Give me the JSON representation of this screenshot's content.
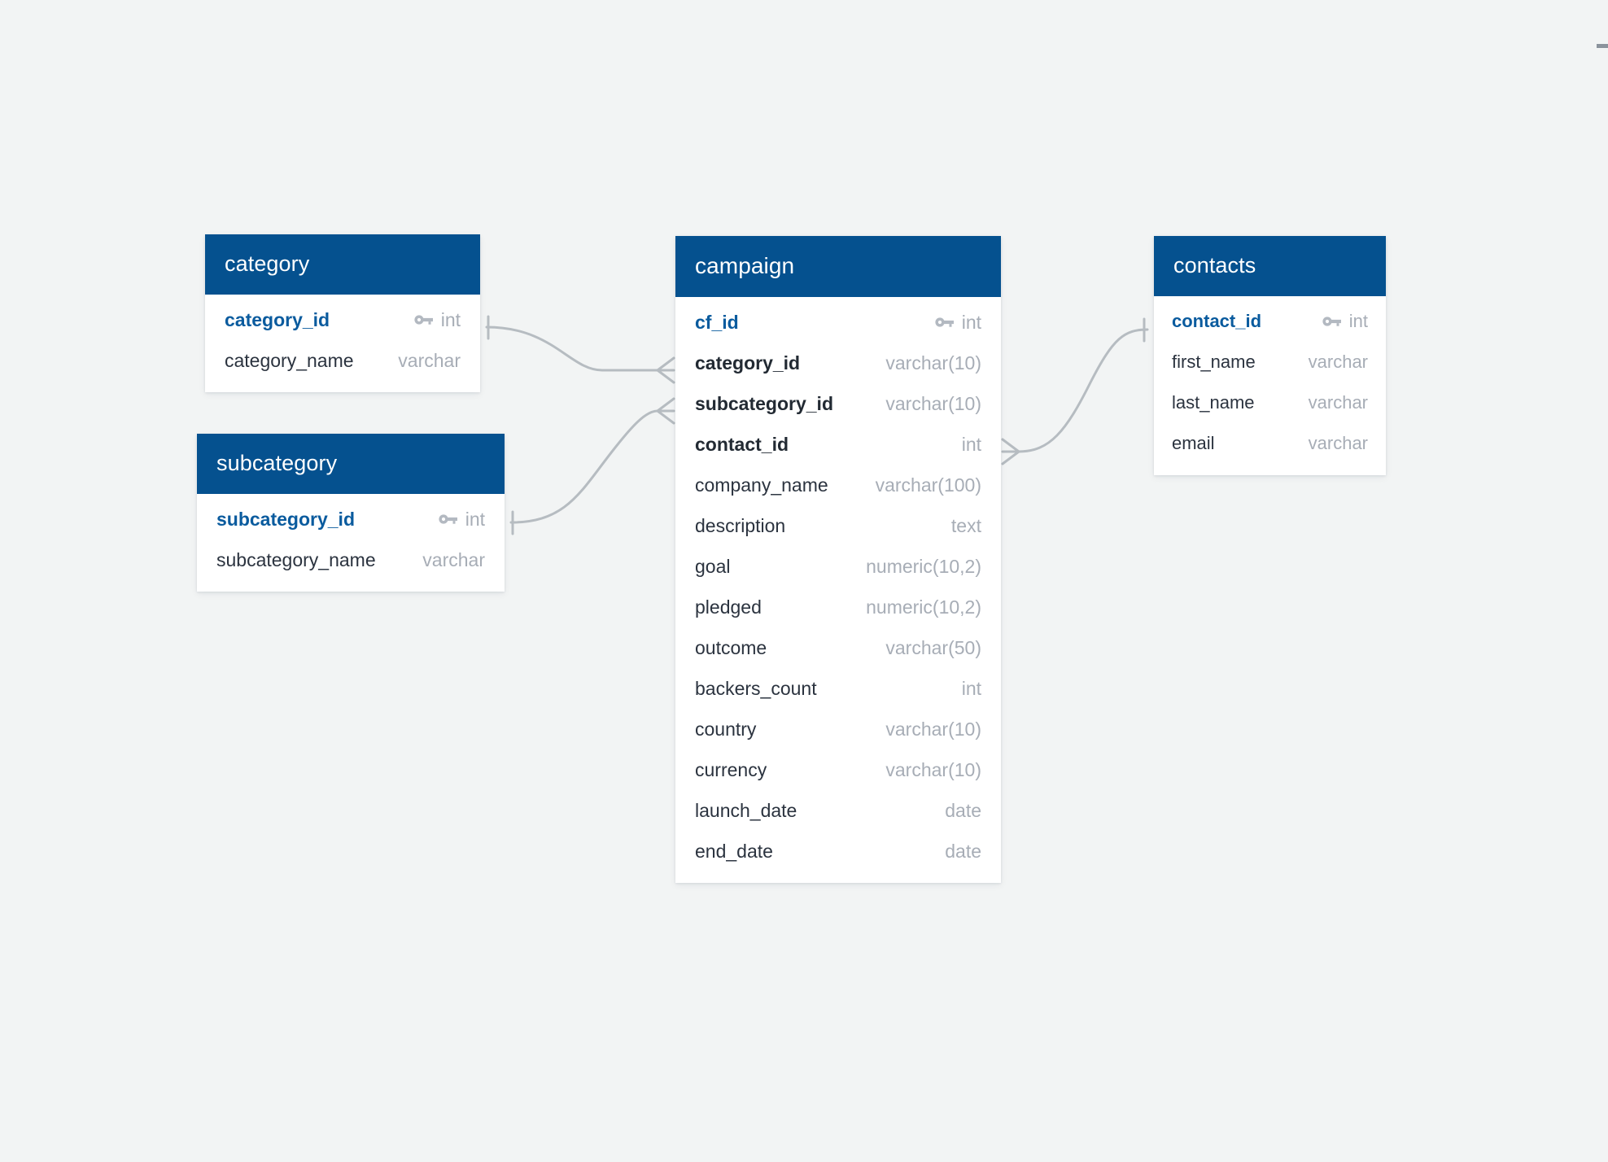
{
  "diagram": {
    "title": "crowdfunding-erd",
    "type": "entity-relationship-diagram",
    "background_color": "#f2f4f4",
    "header_color": "#05518f",
    "pk_text_color": "#0a5b9e",
    "field_text_color": "#2b333f",
    "type_text_color": "#a7adb6",
    "connector_color": "#b6bcc1"
  },
  "entities": [
    {
      "id": "category",
      "name": "category",
      "fields": [
        {
          "name": "category_id",
          "type": "int",
          "key": "pk",
          "icon": "key-icon"
        },
        {
          "name": "category_name",
          "type": "varchar",
          "key": "",
          "icon": ""
        }
      ]
    },
    {
      "id": "subcategory",
      "name": "subcategory",
      "fields": [
        {
          "name": "subcategory_id",
          "type": "int",
          "key": "pk",
          "icon": "key-icon"
        },
        {
          "name": "subcategory_name",
          "type": "varchar",
          "key": "",
          "icon": ""
        }
      ]
    },
    {
      "id": "campaign",
      "name": "campaign",
      "fields": [
        {
          "name": "cf_id",
          "type": "int",
          "key": "pk",
          "icon": "key-icon"
        },
        {
          "name": "category_id",
          "type": "varchar(10)",
          "key": "fk",
          "icon": ""
        },
        {
          "name": "subcategory_id",
          "type": "varchar(10)",
          "key": "fk",
          "icon": ""
        },
        {
          "name": "contact_id",
          "type": "int",
          "key": "fk",
          "icon": ""
        },
        {
          "name": "company_name",
          "type": "varchar(100)",
          "key": "",
          "icon": ""
        },
        {
          "name": "description",
          "type": "text",
          "key": "",
          "icon": ""
        },
        {
          "name": "goal",
          "type": "numeric(10,2)",
          "key": "",
          "icon": ""
        },
        {
          "name": "pledged",
          "type": "numeric(10,2)",
          "key": "",
          "icon": ""
        },
        {
          "name": "outcome",
          "type": "varchar(50)",
          "key": "",
          "icon": ""
        },
        {
          "name": "backers_count",
          "type": "int",
          "key": "",
          "icon": ""
        },
        {
          "name": "country",
          "type": "varchar(10)",
          "key": "",
          "icon": ""
        },
        {
          "name": "currency",
          "type": "varchar(10)",
          "key": "",
          "icon": ""
        },
        {
          "name": "launch_date",
          "type": "date",
          "key": "",
          "icon": ""
        },
        {
          "name": "end_date",
          "type": "date",
          "key": "",
          "icon": ""
        }
      ]
    },
    {
      "id": "contacts",
      "name": "contacts",
      "fields": [
        {
          "name": "contact_id",
          "type": "int",
          "key": "pk",
          "icon": "key-icon"
        },
        {
          "name": "first_name",
          "type": "varchar",
          "key": "",
          "icon": ""
        },
        {
          "name": "last_name",
          "type": "varchar",
          "key": "",
          "icon": ""
        },
        {
          "name": "email",
          "type": "varchar",
          "key": "",
          "icon": ""
        }
      ]
    }
  ],
  "relationships": [
    {
      "id": "category-to-campaign",
      "from_entity": "category",
      "from_field": "category_id",
      "from_cardinality": "one",
      "to_entity": "campaign",
      "to_field": "category_id",
      "to_cardinality": "many"
    },
    {
      "id": "subcategory-to-campaign",
      "from_entity": "subcategory",
      "from_field": "subcategory_id",
      "from_cardinality": "one",
      "to_entity": "campaign",
      "to_field": "subcategory_id",
      "to_cardinality": "many"
    },
    {
      "id": "contacts-to-campaign",
      "from_entity": "contacts",
      "from_field": "contact_id",
      "from_cardinality": "one",
      "to_entity": "campaign",
      "to_field": "contact_id",
      "to_cardinality": "many"
    }
  ]
}
